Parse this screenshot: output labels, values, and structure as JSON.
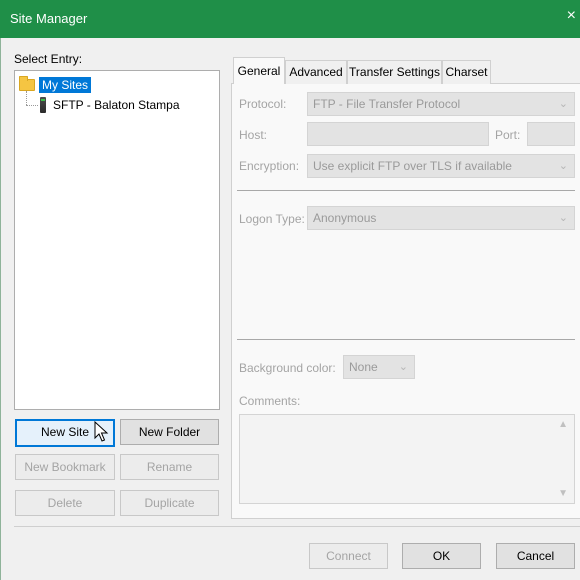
{
  "window": {
    "title": "Site Manager",
    "close_glyph": "×"
  },
  "select_entry_label": "Select Entry:",
  "tree": {
    "root": {
      "label": "My Sites",
      "icon": "folder-icon",
      "selected": true
    },
    "children": [
      {
        "label": "SFTP - Balaton Stampa",
        "icon": "server-icon"
      }
    ]
  },
  "left_buttons": {
    "new_site": "New Site",
    "new_folder": "New Folder",
    "new_bookmark": "New Bookmark",
    "rename": "Rename",
    "delete": "Delete",
    "duplicate": "Duplicate"
  },
  "tabs": [
    {
      "label": "General",
      "active": true
    },
    {
      "label": "Advanced",
      "active": false
    },
    {
      "label": "Transfer Settings",
      "active": false
    },
    {
      "label": "Charset",
      "active": false
    }
  ],
  "general": {
    "protocol_label": "Protocol:",
    "protocol_value": "FTP - File Transfer Protocol",
    "host_label": "Host:",
    "host_value": "",
    "port_label": "Port:",
    "port_value": "",
    "encryption_label": "Encryption:",
    "encryption_value": "Use explicit FTP over TLS if available",
    "logon_type_label": "Logon Type:",
    "logon_type_value": "Anonymous",
    "background_color_label": "Background color:",
    "background_color_value": "None",
    "comments_label": "Comments:",
    "comments_value": ""
  },
  "dialog_buttons": {
    "connect": "Connect",
    "ok": "OK",
    "cancel": "Cancel"
  },
  "colors": {
    "titlebar": "#1f8f48",
    "selection": "#0078d7"
  }
}
